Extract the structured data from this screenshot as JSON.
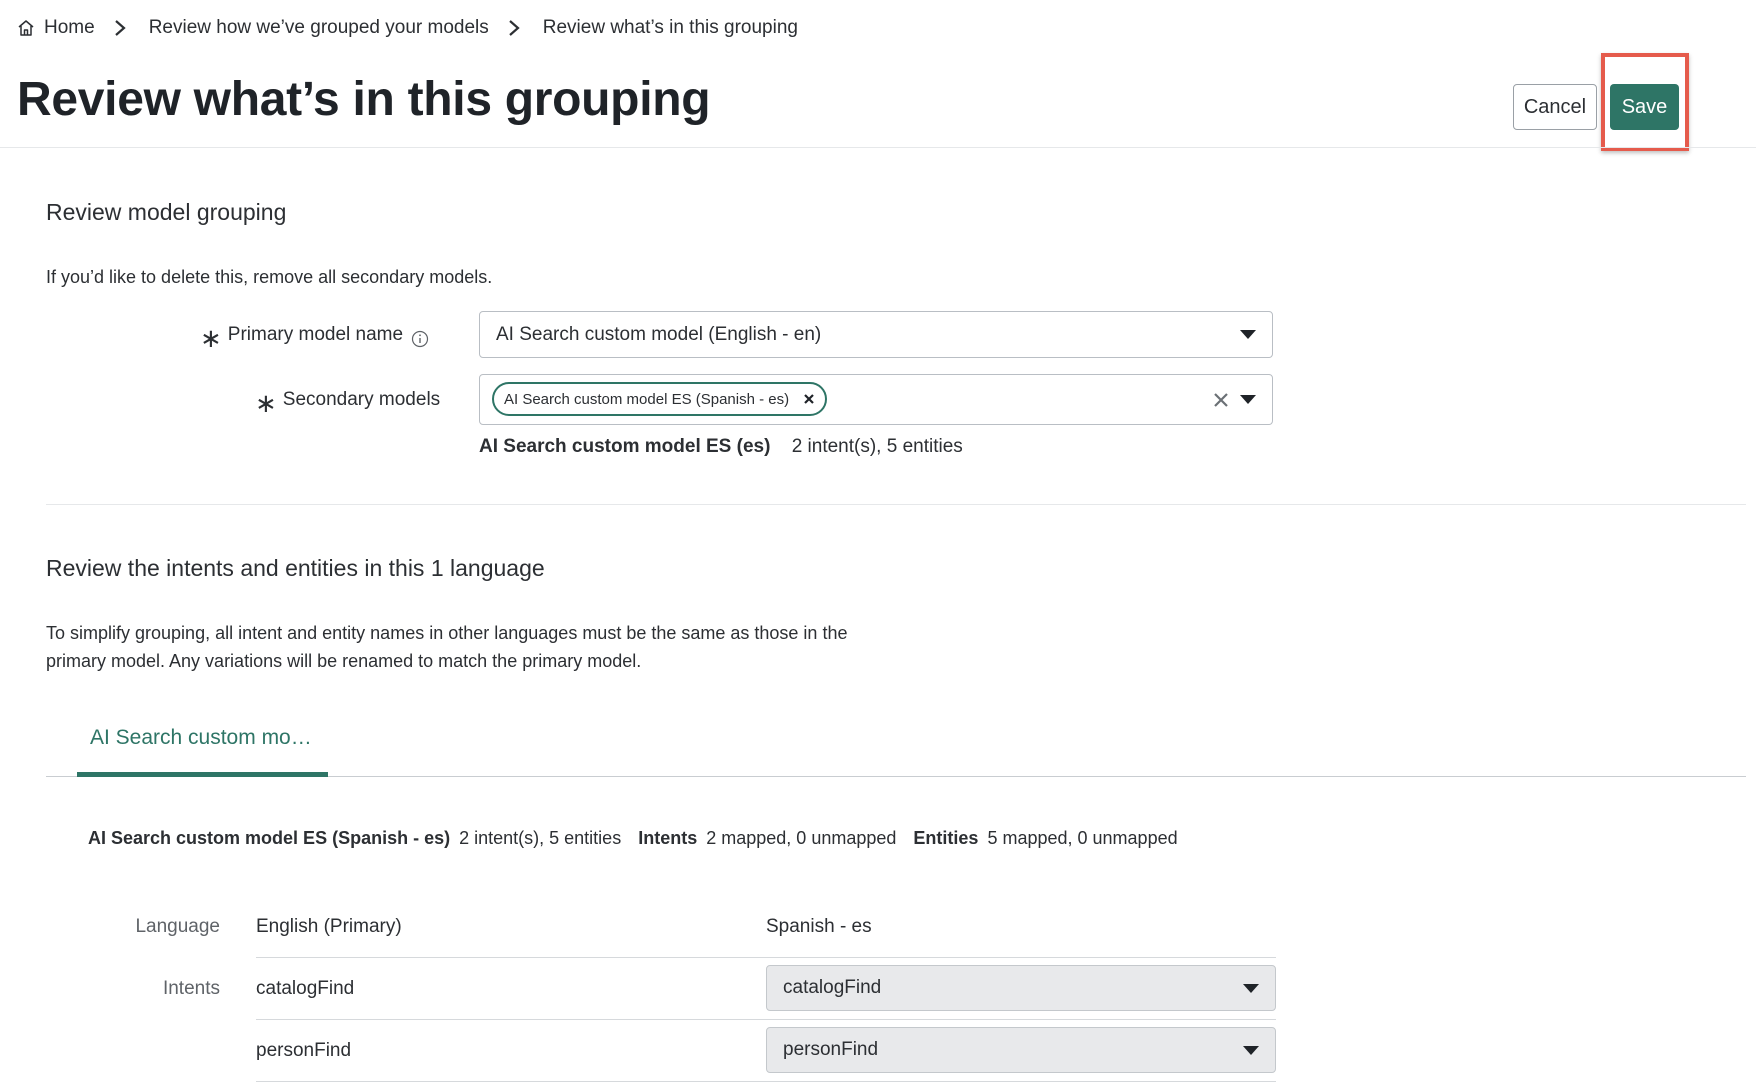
{
  "breadcrumb": {
    "home": "Home",
    "items": [
      "Review how we’ve grouped your models",
      "Review what’s in this grouping"
    ]
  },
  "header": {
    "title": "Review what’s in this grouping",
    "cancel_label": "Cancel",
    "save_label": "Save"
  },
  "grouping": {
    "section_title": "Review model grouping",
    "instructions": "If you’d like to delete this, remove all secondary models.",
    "primary_label": "Primary model name",
    "primary_value": "AI Search custom model (English - en)",
    "secondary_label": "Secondary models",
    "secondary_tag": "AI Search custom model ES (Spanish - es)",
    "summary_model": "AI Search custom model ES (es)",
    "summary_counts": "2 intent(s), 5 entities"
  },
  "intents_section": {
    "title": "Review the intents and entities in this 1 language",
    "description_line1": "To simplify grouping, all intent and entity names in other languages must be the same as those in the",
    "description_line2": "primary model. Any variations will be renamed to match the primary model.",
    "tab_label": "AI Search custom mo…",
    "summary": {
      "model": "AI Search custom model ES (Spanish - es)",
      "counts": "2 intent(s), 5 entities",
      "intents_label": "Intents",
      "intents_value": "2 mapped, 0 unmapped",
      "entities_label": "Entities",
      "entities_value": "5 mapped, 0 unmapped"
    }
  },
  "mapping": {
    "language_label": "Language",
    "primary_language": "English (Primary)",
    "secondary_language": "Spanish - es",
    "intents_label": "Intents",
    "rows": [
      {
        "primary": "catalogFind",
        "secondary": "catalogFind"
      },
      {
        "primary": "personFind",
        "secondary": "personFind"
      }
    ]
  },
  "colors": {
    "accent": "#2e7566",
    "highlight": "#e55b4c"
  }
}
